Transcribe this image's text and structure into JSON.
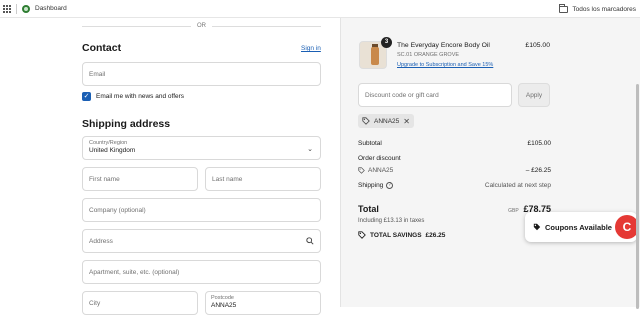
{
  "bookmarks": {
    "dashboard": "Dashboard",
    "all_bookmarks": "Todos los marcadores"
  },
  "left": {
    "or_label": "OR",
    "contact_title": "Contact",
    "signin_label": "Sign in",
    "email_placeholder": "Email",
    "newsletter_label": "Email me with news and offers",
    "newsletter_checked": true,
    "shipping_title": "Shipping address",
    "country_label": "Country/Region",
    "country_value": "United Kingdom",
    "first_name_placeholder": "First name",
    "last_name_placeholder": "Last name",
    "company_placeholder": "Company (optional)",
    "address_placeholder": "Address",
    "apartment_placeholder": "Apartment, suite, etc. (optional)",
    "city_placeholder": "City",
    "postcode_label": "Postcode",
    "postcode_value": "ANNA25"
  },
  "summary": {
    "product": {
      "quantity": "3",
      "name": "The Everyday Encore Body Oil",
      "variant": "SC.01 ORANGE GROVE",
      "subscribe_link": "Upgrade to Subscription and Save 15%",
      "price": "£105.00"
    },
    "discount_placeholder": "Discount code or gift card",
    "apply_label": "Apply",
    "applied_code": "ANNA25",
    "subtotal_label": "Subtotal",
    "subtotal_value": "£105.00",
    "order_discount_label": "Order discount",
    "discount_code": "ANNA25",
    "discount_value": "– £26.25",
    "shipping_label": "Shipping",
    "shipping_value": "Calculated at next step",
    "total_label": "Total",
    "currency": "GBP",
    "total_value": "£78.75",
    "taxes_text": "Including £13.13 in taxes",
    "savings_label": "TOTAL SAVINGS",
    "savings_value": "£26.25"
  },
  "coupon_widget": {
    "label": "Coupons Available",
    "logo_letter": "C"
  },
  "colors": {
    "link": "#1a5fb4",
    "coupon_red": "#e53935",
    "summary_bg": "#f5f5f5"
  }
}
